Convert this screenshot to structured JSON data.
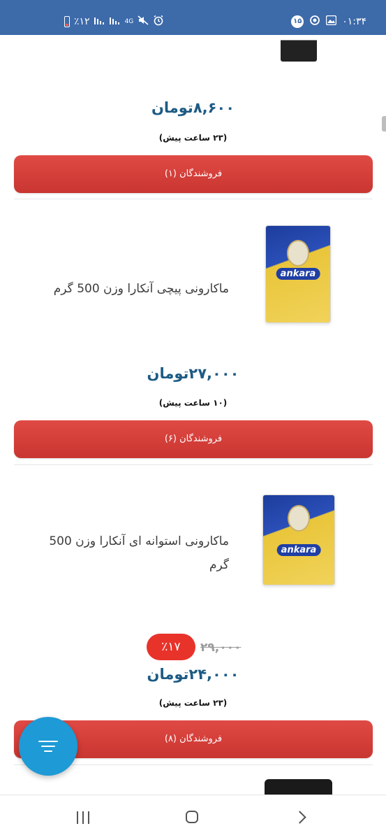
{
  "status_bar": {
    "time": "۰۱:۳۴",
    "notification_count": "۱۵",
    "battery_percent": "٪۱۲",
    "network_type": "4G"
  },
  "products": [
    {
      "price": "۸,۶۰۰تومان",
      "time_ago": "(۲۳ ساعت پیش)",
      "sellers_button": "فروشندگان (۱)"
    },
    {
      "title": "ماکارونی پیچی آنکارا وزن 500 گرم",
      "image_label": "ankara",
      "price": "۲۷,۰۰۰تومان",
      "time_ago": "(۱۰ ساعت پیش)",
      "sellers_button": "فروشندگان (۶)"
    },
    {
      "title_line1": "ماکارونی استوانه ای آنکارا وزن 500",
      "title_line2": "گرم",
      "image_label": "ankara",
      "old_price": "۲۹,۰۰۰",
      "discount": "٪۱۷",
      "price": "۲۴,۰۰۰تومان",
      "time_ago": "(۲۳ ساعت پیش)",
      "sellers_button": "فروشندگان (۸)"
    }
  ],
  "colors": {
    "status_bar": "#3d6aa9",
    "price": "#1d5b84",
    "sellers_button": "#d63e3a",
    "discount_badge": "#e8332b",
    "fab": "#1e9ad6"
  },
  "icons": {
    "fab": "filter-icon",
    "nav": [
      "recents-icon",
      "home-icon",
      "back-icon"
    ]
  }
}
